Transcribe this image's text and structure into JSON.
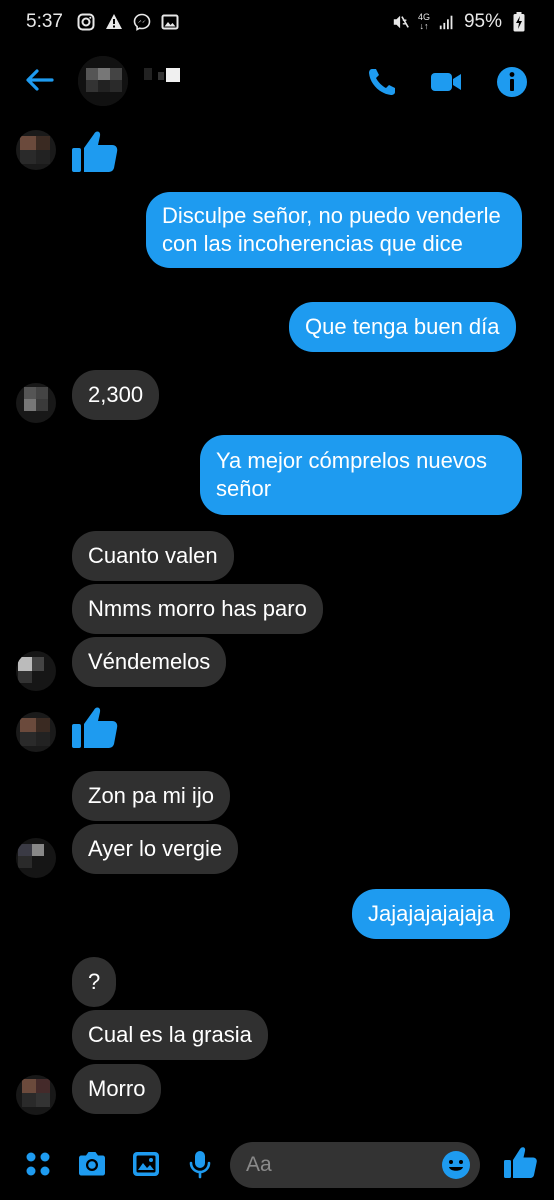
{
  "status_bar": {
    "time": "5:37",
    "battery": "95%",
    "network": "4G"
  },
  "header": {
    "back_icon": "arrow-left-icon",
    "call_icon": "phone-icon",
    "video_icon": "video-camera-icon",
    "info_icon": "info-icon"
  },
  "messages": [
    {
      "type": "thumb"
    },
    {
      "side": "out",
      "text": "Disculpe señor, no puedo venderle con las incoherencias que dice"
    },
    {
      "side": "out",
      "text": "Que tenga buen día"
    },
    {
      "side": "in",
      "text": "2,300"
    },
    {
      "side": "out",
      "text": "Ya mejor cómprelos nuevos señor"
    },
    {
      "side": "in",
      "text": "Cuanto valen"
    },
    {
      "side": "in",
      "text": "Nmms morro has paro"
    },
    {
      "side": "in",
      "text": "Véndemelos"
    },
    {
      "type": "thumb"
    },
    {
      "side": "in",
      "text": "Zon pa mi ijo"
    },
    {
      "side": "in",
      "text": "Ayer lo vergie"
    },
    {
      "side": "out",
      "text": "Jajajajajajaja"
    },
    {
      "side": "in",
      "text": "?"
    },
    {
      "side": "in",
      "text": "Cual es la grasia"
    },
    {
      "side": "in",
      "text": "Morro"
    }
  ],
  "composer": {
    "placeholder": "Aa",
    "icons": [
      "apps-icon",
      "camera-icon",
      "gallery-icon",
      "microphone-icon",
      "emoji-icon",
      "thumbs-up-icon"
    ]
  },
  "colors": {
    "accent": "#1e9bf0",
    "outgoing_bubble": "#1e9bf0",
    "incoming_bubble": "#303030",
    "background": "#000000"
  }
}
